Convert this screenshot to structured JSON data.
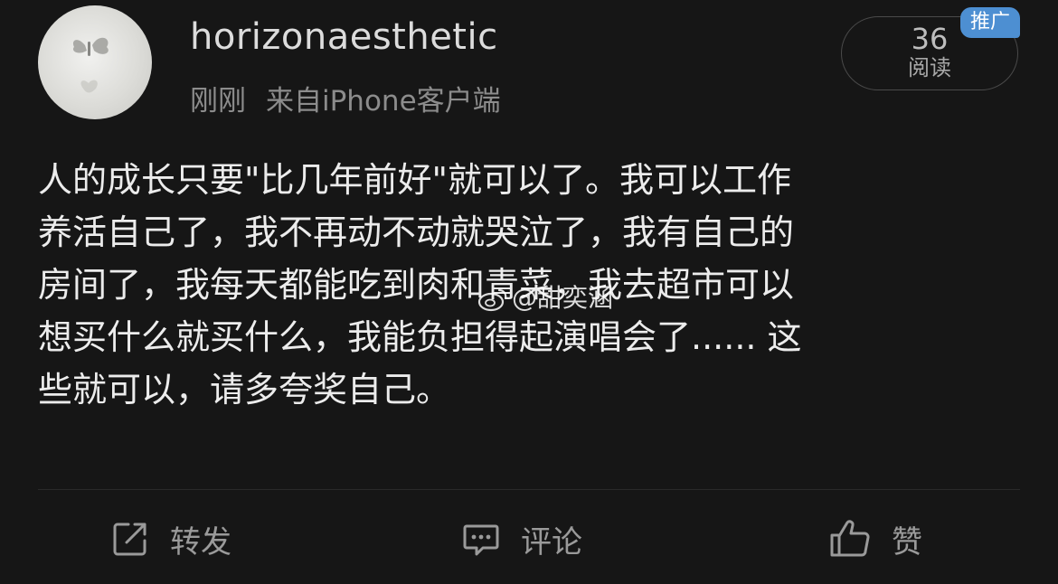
{
  "header": {
    "username": "horizonaesthetic",
    "time": "刚刚",
    "source": "来自",
    "client": "iPhone客户端",
    "read_count": "36",
    "read_label": "阅读",
    "promo_badge": "推广"
  },
  "post": {
    "lines": [
      "人的成长只要\"比几年前好\"就可以了。我可以工作",
      "养活自己了，我不再动不动就哭泣了，我有自己的",
      "房间了，我每天都能吃到肉和青菜，我去超市可以",
      "想买什么就买什么，我能负担得起演唱会了...... 这",
      "些就可以，请多夸奖自己。"
    ],
    "watermark": "@甜奕涵"
  },
  "actions": {
    "repost": "转发",
    "comment": "评论",
    "like": "赞"
  },
  "icons": {
    "avatar": "butterfly-avatar-icon",
    "repost": "repost-icon",
    "comment": "comment-icon",
    "like": "thumbs-up-icon",
    "watermark": "weibo-icon"
  },
  "colors": {
    "background": "#161616",
    "promo_badge": "#4d8fd2",
    "text": "#ececec",
    "meta": "#8c8c8c"
  }
}
